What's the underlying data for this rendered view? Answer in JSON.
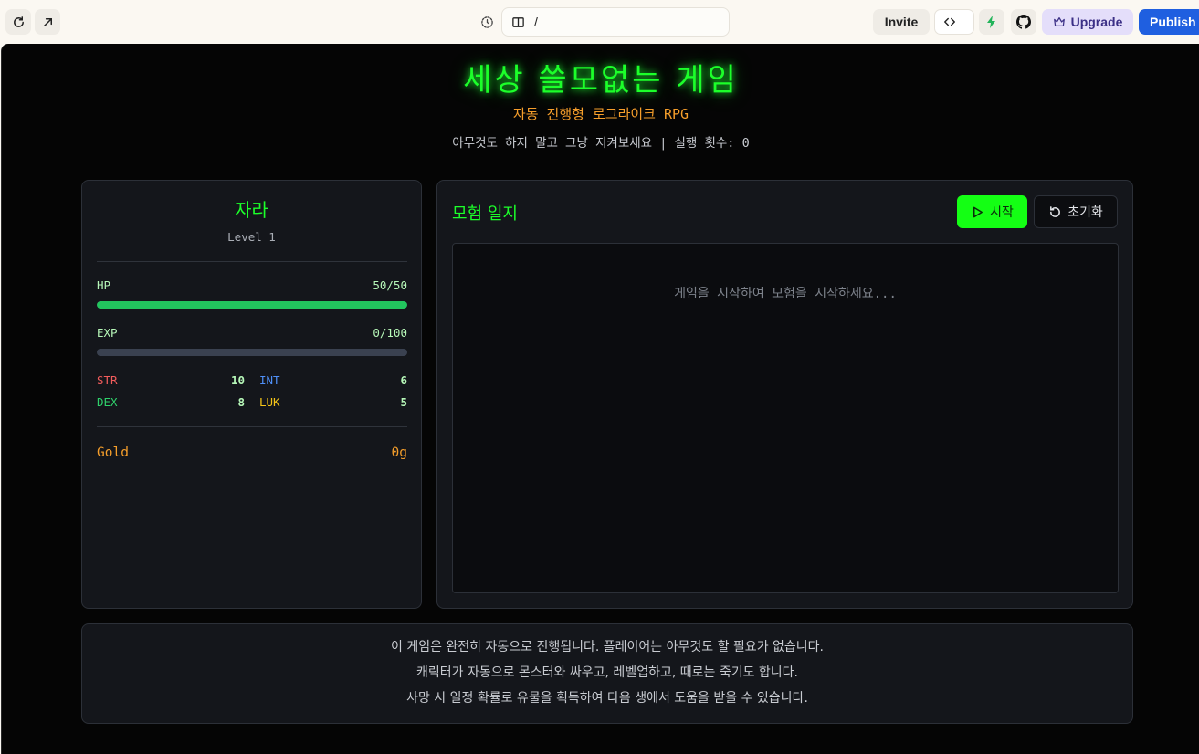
{
  "topbar": {
    "url_path": "/",
    "invite_label": "Invite",
    "upgrade_label": "Upgrade",
    "publish_label": "Publish",
    "icons": {
      "refresh": "refresh-icon",
      "open_external": "arrow-up-right-icon",
      "history": "history-icon",
      "page": "book-icon",
      "code": "code-icon",
      "bolt": "bolt-icon",
      "github": "github-icon",
      "crown": "crown-icon"
    }
  },
  "game": {
    "title": "세상 쓸모없는 게임",
    "subtitle": "자동 진행형 로그라이크 RPG",
    "tagline_prefix": "아무것도 하지 말고 그냥 지켜보세요 | 실행 횟수: ",
    "run_count": "0"
  },
  "character": {
    "name": "자라",
    "level": "Level 1",
    "hp_label": "HP",
    "hp_value": "50/50",
    "hp_fraction": 1.0,
    "exp_label": "EXP",
    "exp_value": "0/100",
    "exp_fraction": 0.0,
    "stats": [
      {
        "name": "STR",
        "value": "10",
        "color": "#f25c5c"
      },
      {
        "name": "INT",
        "value": "6",
        "color": "#4f8ff7"
      },
      {
        "name": "DEX",
        "value": "8",
        "color": "#2fd16b"
      },
      {
        "name": "LUK",
        "value": "5",
        "color": "#f5c518"
      }
    ],
    "gold_label": "Gold",
    "gold_value": "0g"
  },
  "log": {
    "title": "모험 일지",
    "start_label": "시작",
    "reset_label": "초기화",
    "empty_message": "게임을 시작하여 모험을 시작하세요..."
  },
  "info": {
    "lines": [
      "이 게임은 완전히 자동으로 진행됩니다. 플레이어는 아무것도 할 필요가 없습니다.",
      "캐릭터가 자동으로 몬스터와 싸우고, 레벨업하고, 때로는 죽기도 합니다.",
      "사망 시 일정 확률로 유물을 획득하여 다음 생에서 도움을 받을 수 있습니다."
    ]
  },
  "colors": {
    "accent_green": "#1cff2a",
    "orange": "#f59e2b",
    "hp_bar": "#22c55e",
    "panel_bg": "#14161b"
  }
}
